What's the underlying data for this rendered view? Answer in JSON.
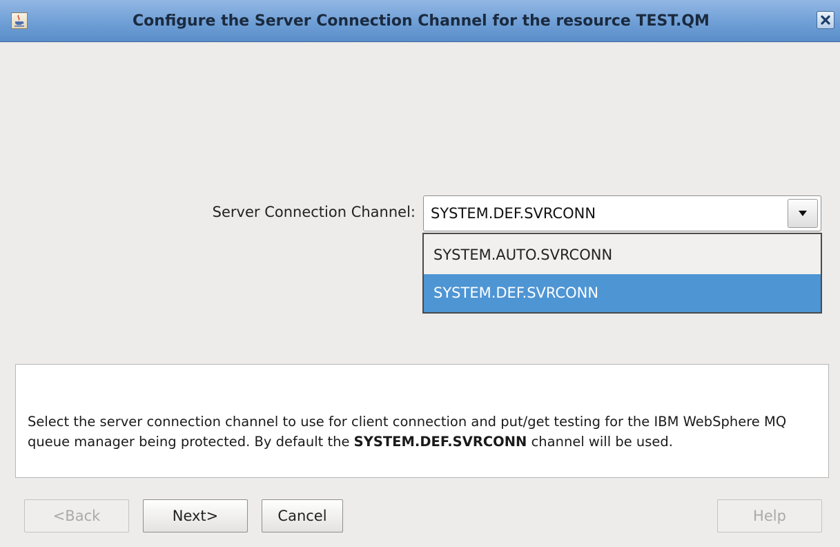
{
  "window": {
    "title": "Configure the Server Connection Channel for the resource TEST.QM"
  },
  "form": {
    "channel_label": "Server Connection Channel:",
    "channel_value": "SYSTEM.DEF.SVRCONN",
    "channel_options": [
      "SYSTEM.AUTO.SVRCONN",
      "SYSTEM.DEF.SVRCONN"
    ],
    "selected_index": 1
  },
  "description": {
    "part1": "Select the server connection channel to use for client connection and put/get testing for the IBM WebSphere MQ queue manager being protected. By default the ",
    "bold": "SYSTEM.DEF.SVRCONN",
    "part2": " channel will be used."
  },
  "buttons": {
    "back": "<Back",
    "next": "Next>",
    "cancel": "Cancel",
    "help": "Help"
  },
  "colors": {
    "title_bar": "#6f9fd6",
    "selection": "#4e95d4",
    "background": "#edeceb"
  },
  "icons": {
    "app": "java-app-icon",
    "close": "close-icon",
    "dropdown": "triangle-down-icon"
  }
}
